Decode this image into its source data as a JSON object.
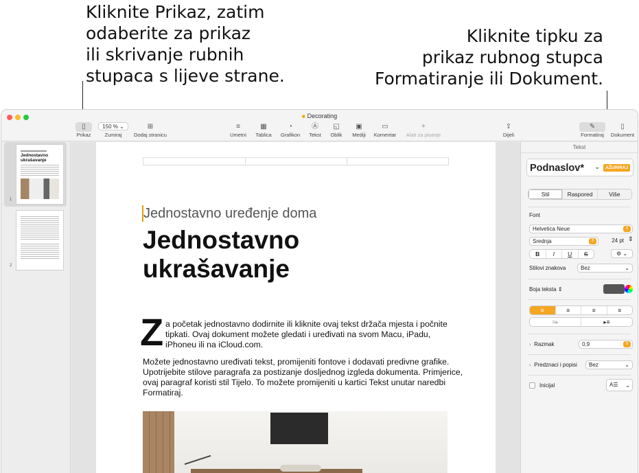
{
  "callouts": {
    "left": [
      "Kliknite Prikaz, zatim",
      "odaberite za prikaz",
      "ili skrivanje rubnih",
      "stupaca s lijeve strane."
    ],
    "right": [
      "Kliknite tipku za",
      "prikaz rubnog stupca",
      "Formatiranje ili Dokument."
    ]
  },
  "window": {
    "title": "Decorating",
    "colors": {
      "close": "#fe5f57",
      "minimize": "#febc2e",
      "zoom": "#28c840",
      "accent": "#f5a623"
    }
  },
  "toolbar": {
    "view_label": "Prikaz",
    "zoom_value": "150 %",
    "zoom_label": "Zumiraj",
    "add_page_label": "Dodaj stranicu",
    "insert_label": "Umetni",
    "table_label": "Tablica",
    "chart_label": "Grafikon",
    "text_label": "Tekst",
    "shape_label": "Oblik",
    "media_label": "Mediji",
    "comment_label": "Komentar",
    "writing_tools_label": "Alati za pisanje",
    "share_label": "Dijeli",
    "format_label": "Formatiraj",
    "document_label": "Dokument"
  },
  "sidebar": {
    "pages": [
      {
        "number": "1",
        "thumb_title": "Jednostavno ukrašavanje"
      },
      {
        "number": "2"
      }
    ]
  },
  "document": {
    "subtitle": "Jednostavno uređenje doma",
    "title_lines": [
      "Jednostavno",
      "ukrašavanje"
    ],
    "dropcap": "Z",
    "para1": "a početak jednostavno dodirnite ili kliknite ovaj tekst držača mjesta i počnite tipkati. Ovaj dokument možete gledati i uređivati na svom Macu, iPadu, iPhoneu ili na iCloud.com.",
    "para2": "Možete jednostavno uređivati tekst, promijeniti fontove i dodavati predivne grafike. Upotrijebite stilove paragrafa za postizanje dosljednog izgleda dokumenta. Primjerice, ovaj paragraf koristi stil Tijelo. To možete promijeniti u kartici Tekst unutar naredbi Formatiraj."
  },
  "inspector": {
    "heading": "Tekst",
    "style_name": "Podnaslov*",
    "update_button": "AŽURIRAJ",
    "tabs": [
      "Stil",
      "Raspored",
      "Više"
    ],
    "font_section": "Font",
    "font_name": "Helvetica Neue",
    "font_weight": "Srednja",
    "font_size": "24 pt",
    "bold": "B",
    "italic": "I",
    "underline": "U",
    "strike": "S",
    "char_styles_label": "Stilovi znakova",
    "char_styles_value": "Bez",
    "text_color_label": "Boja teksta",
    "text_color": "#555555",
    "spacing_label": "Razmak",
    "spacing_value": "0,9",
    "bullets_label": "Predznaci i popisi",
    "bullets_value": "Bez",
    "initial_label": "Inicijal"
  }
}
